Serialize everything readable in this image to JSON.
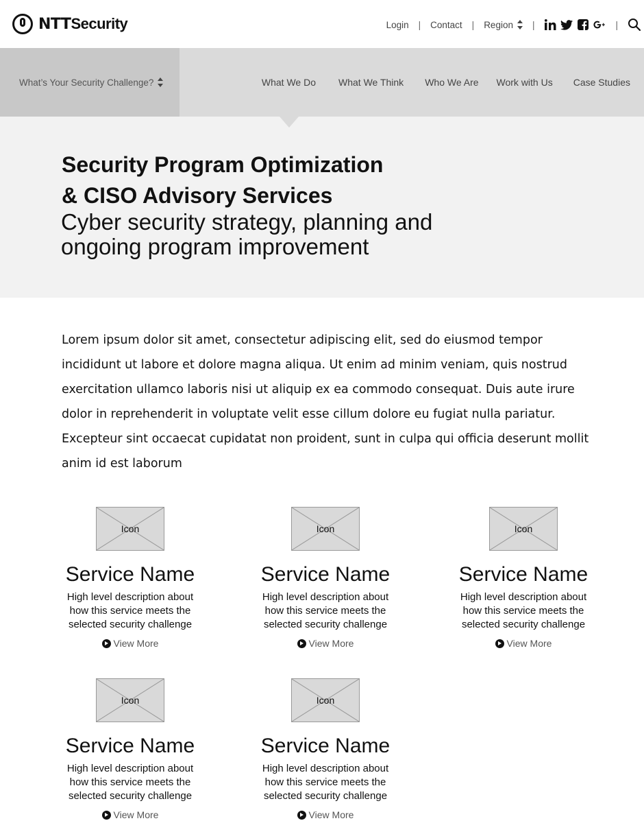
{
  "header": {
    "logo": {
      "brand_bold": "NTT",
      "brand_rest": "Security"
    },
    "utility": {
      "login_label": "Login",
      "contact_label": "Contact",
      "region_label": "Region",
      "separator": "|"
    },
    "social_icons": [
      "linkedin-icon",
      "twitter-icon",
      "facebook-icon",
      "google-plus-icon"
    ]
  },
  "nav": {
    "challenge_label": "What’s Your Security Challenge?",
    "items": [
      {
        "label": "What We Do"
      },
      {
        "label": "What We Think"
      },
      {
        "label": "Who We Are"
      },
      {
        "label": "Work with Us"
      },
      {
        "label": "Case Studies"
      }
    ]
  },
  "hero": {
    "title_line1": "Security Program Optimization",
    "title_line2": "& CISO Advisory Services",
    "subtitle_line1": "Cyber security strategy, planning and",
    "subtitle_line2": "ongoing program improvement"
  },
  "intro": "Lorem ipsum dolor sit amet, consectetur adipiscing elit, sed do eiusmod tempor incididunt ut labore et dolore magna aliqua. Ut enim ad minim veniam, quis nostrud exercitation ullamco laboris nisi ut aliquip ex ea commodo consequat. Duis aute irure dolor in reprehenderit in voluptate velit esse cillum dolore eu fugiat nulla pariatur. Excepteur sint occaecat cupidatat non proident, sunt in culpa qui officia deserunt mollit anim id est laborum",
  "services": [
    {
      "icon_label": "Icon",
      "name": "Service Name",
      "desc_line1": "High level description about",
      "desc_line2": "how this service meets the",
      "desc_line3": "selected security challenge",
      "link_label": "View More"
    },
    {
      "icon_label": "Icon",
      "name": "Service Name",
      "desc_line1": "High level description about",
      "desc_line2": "how this service meets the",
      "desc_line3": "selected security challenge",
      "link_label": "View More"
    },
    {
      "icon_label": "Icon",
      "name": "Service Name",
      "desc_line1": "High level description about",
      "desc_line2": "how this service meets the",
      "desc_line3": "selected security challenge",
      "link_label": "View More"
    },
    {
      "icon_label": "Icon",
      "name": "Service Name",
      "desc_line1": "High level description about",
      "desc_line2": "how this service meets the",
      "desc_line3": "selected security challenge",
      "link_label": "View More"
    },
    {
      "icon_label": "Icon",
      "name": "Service Name",
      "desc_line1": "High level description about",
      "desc_line2": "how this service meets the",
      "desc_line3": "selected security challenge",
      "link_label": "View More"
    }
  ],
  "colors": {
    "nav_bg": "#dadada",
    "challenge_bg": "#c8c8c8",
    "hero_bg": "#f2f2f2",
    "placeholder_bg": "#d9d9d9"
  }
}
